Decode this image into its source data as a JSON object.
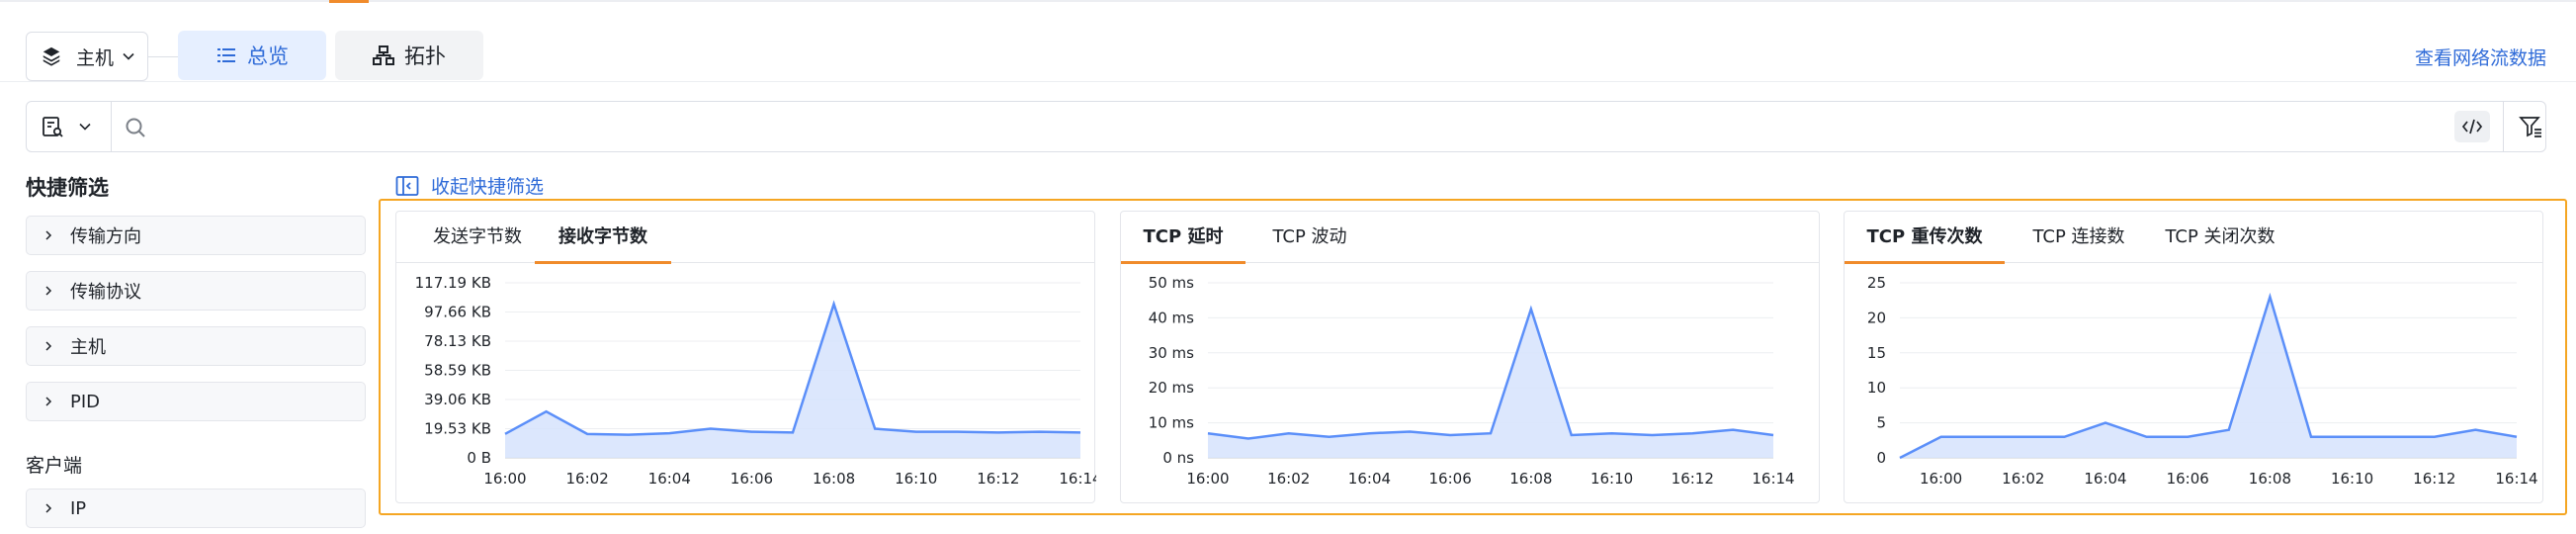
{
  "header": {
    "host_select": "主机",
    "tabs": [
      {
        "label": "总览",
        "active": true
      },
      {
        "label": "拓扑",
        "active": false
      }
    ],
    "view_flow_link": "查看网络流数据"
  },
  "search": {
    "placeholder": "",
    "value": ""
  },
  "quick_filter": {
    "title": "快捷筛选",
    "collapse_label": "收起快捷筛选",
    "items": [
      "传输方向",
      "传输协议",
      "主机",
      "PID"
    ],
    "client_section": "客户端",
    "client_items": [
      "IP"
    ]
  },
  "colors": {
    "accent": "#f08b2b",
    "line": "#5b8ff9",
    "fill": "#d6e3fd",
    "link": "#2f6bd8",
    "highlight_border": "#f5a623"
  },
  "chart_data": [
    {
      "type": "area",
      "tabs": [
        {
          "label": "发送字节数",
          "active": false
        },
        {
          "label": "接收字节数",
          "active": true
        }
      ],
      "x": [
        "16:00",
        "16:01",
        "16:02",
        "16:03",
        "16:04",
        "16:05",
        "16:06",
        "16:07",
        "16:08",
        "16:09",
        "16:10",
        "16:11",
        "16:12",
        "16:13",
        "16:14"
      ],
      "x_ticks": [
        "16:00",
        "16:02",
        "16:04",
        "16:06",
        "16:08",
        "16:10",
        "16:12",
        "16:14"
      ],
      "y_ticks": [
        "0 B",
        "19.53 KB",
        "39.06 KB",
        "58.59 KB",
        "78.13 KB",
        "97.66 KB",
        "117.19 KB"
      ],
      "ylim": [
        0,
        117.19
      ],
      "y_unit": "KB",
      "series": [
        {
          "values": [
            16,
            31,
            16,
            15.5,
            16.5,
            19.5,
            17.5,
            17,
            103,
            19.5,
            17.5,
            17.5,
            17,
            17.5,
            17
          ]
        }
      ]
    },
    {
      "type": "area",
      "tabs": [
        {
          "label": "TCP 延时",
          "active": true
        },
        {
          "label": "TCP 波动",
          "active": false
        }
      ],
      "x": [
        "16:00",
        "16:01",
        "16:02",
        "16:03",
        "16:04",
        "16:05",
        "16:06",
        "16:07",
        "16:08",
        "16:09",
        "16:10",
        "16:11",
        "16:12",
        "16:13",
        "16:14"
      ],
      "x_ticks": [
        "16:00",
        "16:02",
        "16:04",
        "16:06",
        "16:08",
        "16:10",
        "16:12",
        "16:14"
      ],
      "y_ticks": [
        "0 ns",
        "10 ms",
        "20 ms",
        "30 ms",
        "40 ms",
        "50 ms"
      ],
      "ylim": [
        0,
        50
      ],
      "y_unit": "ms",
      "series": [
        {
          "values": [
            7,
            5.5,
            7,
            6,
            7,
            7.5,
            6.5,
            7,
            42.5,
            6.5,
            7,
            6.5,
            7,
            8,
            6.5
          ]
        }
      ]
    },
    {
      "type": "area",
      "tabs": [
        {
          "label": "TCP 重传次数",
          "active": true
        },
        {
          "label": "TCP 连接数",
          "active": false
        },
        {
          "label": "TCP 关闭次数",
          "active": false
        }
      ],
      "x": [
        "15:59",
        "16:00",
        "16:01",
        "16:02",
        "16:03",
        "16:04",
        "16:05",
        "16:06",
        "16:07",
        "16:08",
        "16:09",
        "16:10",
        "16:11",
        "16:12",
        "16:13",
        "16:14"
      ],
      "x_ticks": [
        "16:00",
        "16:02",
        "16:04",
        "16:06",
        "16:08",
        "16:10",
        "16:12",
        "16:14"
      ],
      "y_ticks": [
        "0",
        "5",
        "10",
        "15",
        "20",
        "25"
      ],
      "ylim": [
        0,
        25
      ],
      "series": [
        {
          "values": [
            0,
            3,
            3,
            3,
            3,
            5,
            3,
            3,
            4,
            23,
            3,
            3,
            3,
            3,
            4,
            3
          ]
        }
      ]
    }
  ]
}
